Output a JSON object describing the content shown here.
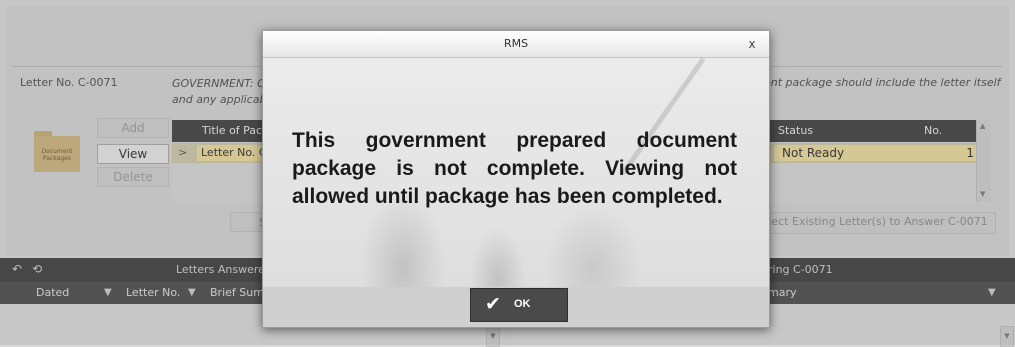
{
  "background": {
    "letter_number": "Letter No. C-0071",
    "description_line1": "GOVERNMENT: C",
    "description_line2": "and any applicab",
    "description_right": "ent package should include the letter itself",
    "folder_label": "Document Packages",
    "side_buttons": {
      "add": "Add",
      "view": "View",
      "delete": "Delete"
    },
    "grid": {
      "headers": {
        "title": "Title of Pac",
        "status": "Status",
        "no": "No."
      },
      "row": {
        "arrow": ">",
        "title": "Letter No. C",
        "status": "Not Ready",
        "no": "1"
      }
    },
    "button_s": "S",
    "select_existing_button": "lect Existing Letter(s) to Answer C-0071",
    "lower_left": {
      "title": "Letters Answere",
      "columns": {
        "dated": "Dated",
        "letter_no": "Letter No.",
        "brief_summary": "Brief Sum"
      }
    },
    "lower_right": {
      "title": "ring C-0071",
      "columns": {
        "summary": "mary"
      }
    }
  },
  "dialog": {
    "title": "RMS",
    "close_label": "x",
    "message": "This government prepared document package is not complete. Viewing not allowed until package has been completed.",
    "ok_label": "OK",
    "ok_icon": "check-icon"
  },
  "colors": {
    "dialog_button": "#4a4a4a",
    "row_highlight": "#e9d99a",
    "header_bar": "#3c3c3c"
  }
}
